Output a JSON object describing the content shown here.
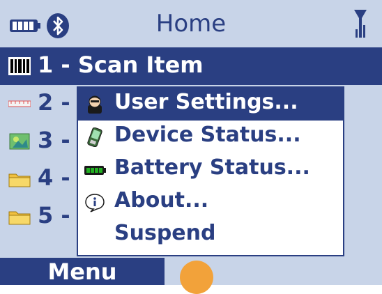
{
  "statusbar": {
    "title": "Home",
    "icons": [
      "battery-icon",
      "bluetooth-icon",
      "signal-antenna-icon"
    ]
  },
  "list": {
    "items": [
      {
        "label": "1 - Scan Item",
        "icon": "barcode-icon",
        "selected": true
      },
      {
        "label": "2 -",
        "icon": "ruler-icon",
        "selected": false
      },
      {
        "label": "3 -",
        "icon": "image-icon",
        "selected": false
      },
      {
        "label": "4 -",
        "icon": "folder-icon",
        "selected": false
      },
      {
        "label": "5 -",
        "icon": "folder-icon",
        "selected": false
      }
    ]
  },
  "popup_menu": {
    "items": [
      {
        "label": "User Settings...",
        "icon": "user-icon",
        "active": true
      },
      {
        "label": "Device Status...",
        "icon": "device-icon",
        "active": false
      },
      {
        "label": "Battery Status...",
        "icon": "battery-icon",
        "active": false
      },
      {
        "label": "About...",
        "icon": "info-icon",
        "active": false
      },
      {
        "label": "Suspend",
        "icon": "",
        "active": false
      }
    ]
  },
  "softkeys": {
    "left": "Menu"
  },
  "colors": {
    "background": "#c8d4e8",
    "accent": "#2a3f82",
    "highlight_text": "#ffffff",
    "orb": "#f2a23a"
  }
}
